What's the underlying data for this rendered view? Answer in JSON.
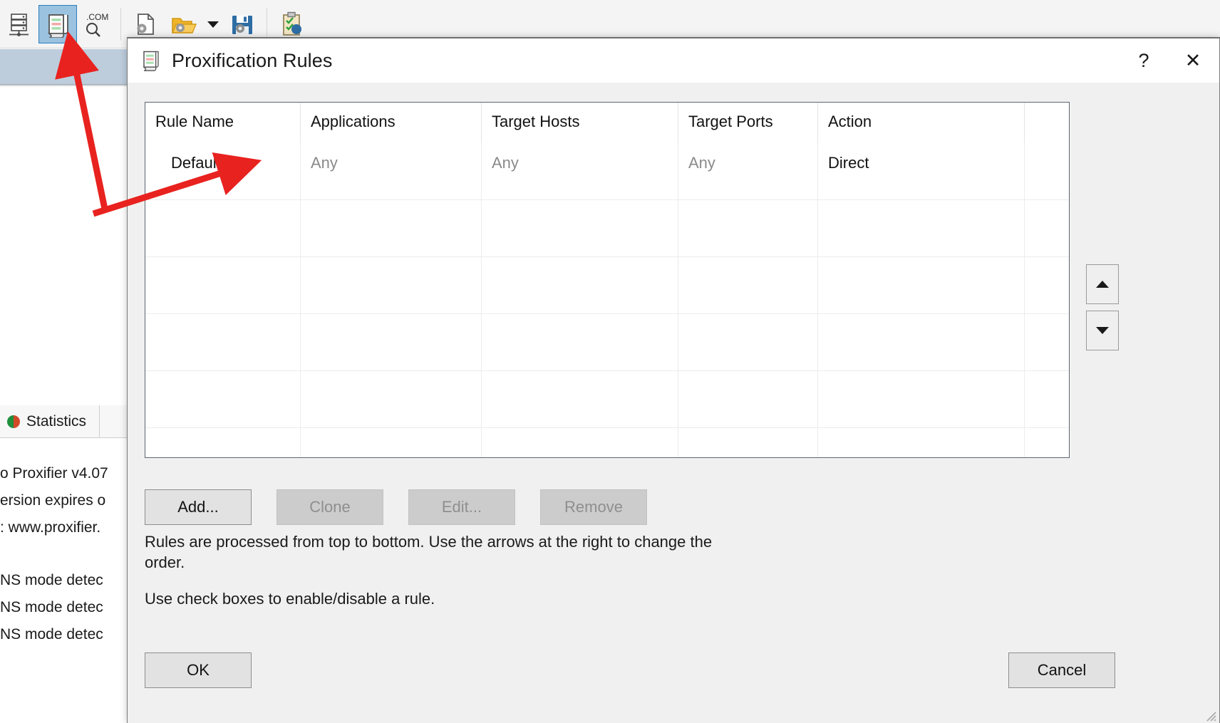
{
  "background": {
    "toolbar": {
      "icons": [
        {
          "name": "server-network-icon",
          "label": "Proxy Servers"
        },
        {
          "name": "proxification-rules-icon",
          "label": "Proxification Rules",
          "active": true
        },
        {
          "name": "name-resolution-icon",
          "label": ".COM"
        },
        {
          "name": "new-profile-icon",
          "label": "New Profile"
        },
        {
          "name": "open-profile-icon",
          "label": "Open Profile"
        },
        {
          "name": "save-profile-icon",
          "label": "Save Profile"
        },
        {
          "name": "log-clipboard-icon",
          "label": "Verify Profile"
        }
      ],
      "com_label": ".COM"
    },
    "tab": {
      "label": "Statistics"
    },
    "log_lines": [
      "o Proxifier v4.07",
      "ersion expires o",
      ": www.proxifier.",
      "NS mode detec",
      "NS mode detec",
      "NS mode detec"
    ]
  },
  "dialog": {
    "title": "Proxification Rules",
    "help_label": "?",
    "close_label": "✕",
    "table": {
      "columns": [
        "Rule Name",
        "Applications",
        "Target Hosts",
        "Target Ports",
        "Action"
      ],
      "rows": [
        {
          "rule_name": "Default",
          "applications": "Any",
          "target_hosts": "Any",
          "target_ports": "Any",
          "action": "Direct"
        }
      ],
      "empty_row_count": 5
    },
    "order_buttons": {
      "move_up": "▲",
      "move_down": "▼"
    },
    "buttons": {
      "add": "Add...",
      "clone": "Clone",
      "edit": "Edit...",
      "remove": "Remove",
      "ok": "OK",
      "cancel": "Cancel"
    },
    "button_states": {
      "add": "enabled",
      "clone": "disabled",
      "edit": "disabled",
      "remove": "disabled"
    },
    "hints": {
      "line1": "Rules are processed from top to bottom. Use the arrows at the right to change the order.",
      "line2": "Use check boxes to enable/disable a rule."
    }
  },
  "annotations": {
    "arrow_color": "#e8221f",
    "arrows": [
      {
        "name": "arrow-to-rules-toolbar-button"
      },
      {
        "name": "arrow-to-default-rule-row"
      }
    ]
  }
}
